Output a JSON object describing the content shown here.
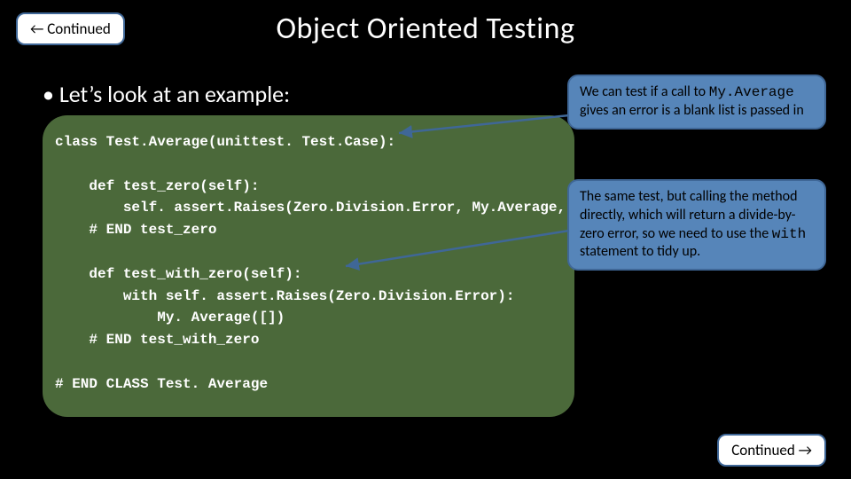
{
  "nav": {
    "prev": "← Continued",
    "next": "Continued →"
  },
  "title": "Object Oriented Testing",
  "bullet": "• Let’s look at an example:",
  "code": "class Test.Average(unittest. Test.Case):\n\n    def test_zero(self):\n        self. assert.Raises(Zero.Division.Error, My.Average, [])\n    # END test_zero\n\n    def test_with_zero(self):\n        with self. assert.Raises(Zero.Division.Error):\n            My. Average([])\n    # END test_with_zero\n\n# END CLASS Test. Average",
  "callouts": {
    "c1_a": "We can test if a call to ",
    "c1_mono": "My.Average",
    "c1_b": " gives an error is a blank list is passed in",
    "c2_a": "The same test, but calling the method directly, which will return a divide-by-zero error, so we need to use the ",
    "c2_mono": "with",
    "c2_b": " statement to tidy up."
  }
}
